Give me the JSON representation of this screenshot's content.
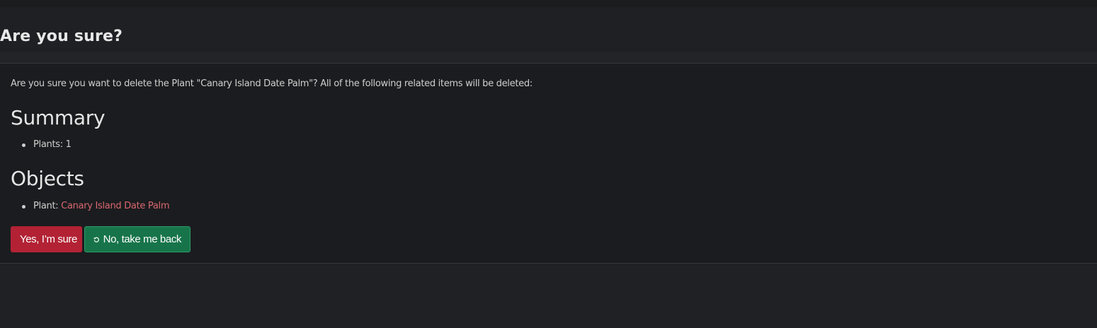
{
  "page": {
    "title": "Are you sure?"
  },
  "confirmation": {
    "message": "Are you sure you want to delete the Plant \"Canary Island Date Palm\"? All of the following related items will be deleted:"
  },
  "summary": {
    "heading": "Summary",
    "items": [
      {
        "text": "Plants: 1"
      }
    ]
  },
  "objects": {
    "heading": "Objects",
    "items": [
      {
        "prefix": "Plant: ",
        "link_text": "Canary Island Date Palm"
      }
    ]
  },
  "actions": {
    "confirm_label": "Yes, I’m sure",
    "cancel_label": "No, take me back",
    "cancel_icon": "undo-icon"
  },
  "colors": {
    "danger": "#b22234",
    "success": "#17744a",
    "link": "#d9686f",
    "background": "#1b1c1f"
  }
}
